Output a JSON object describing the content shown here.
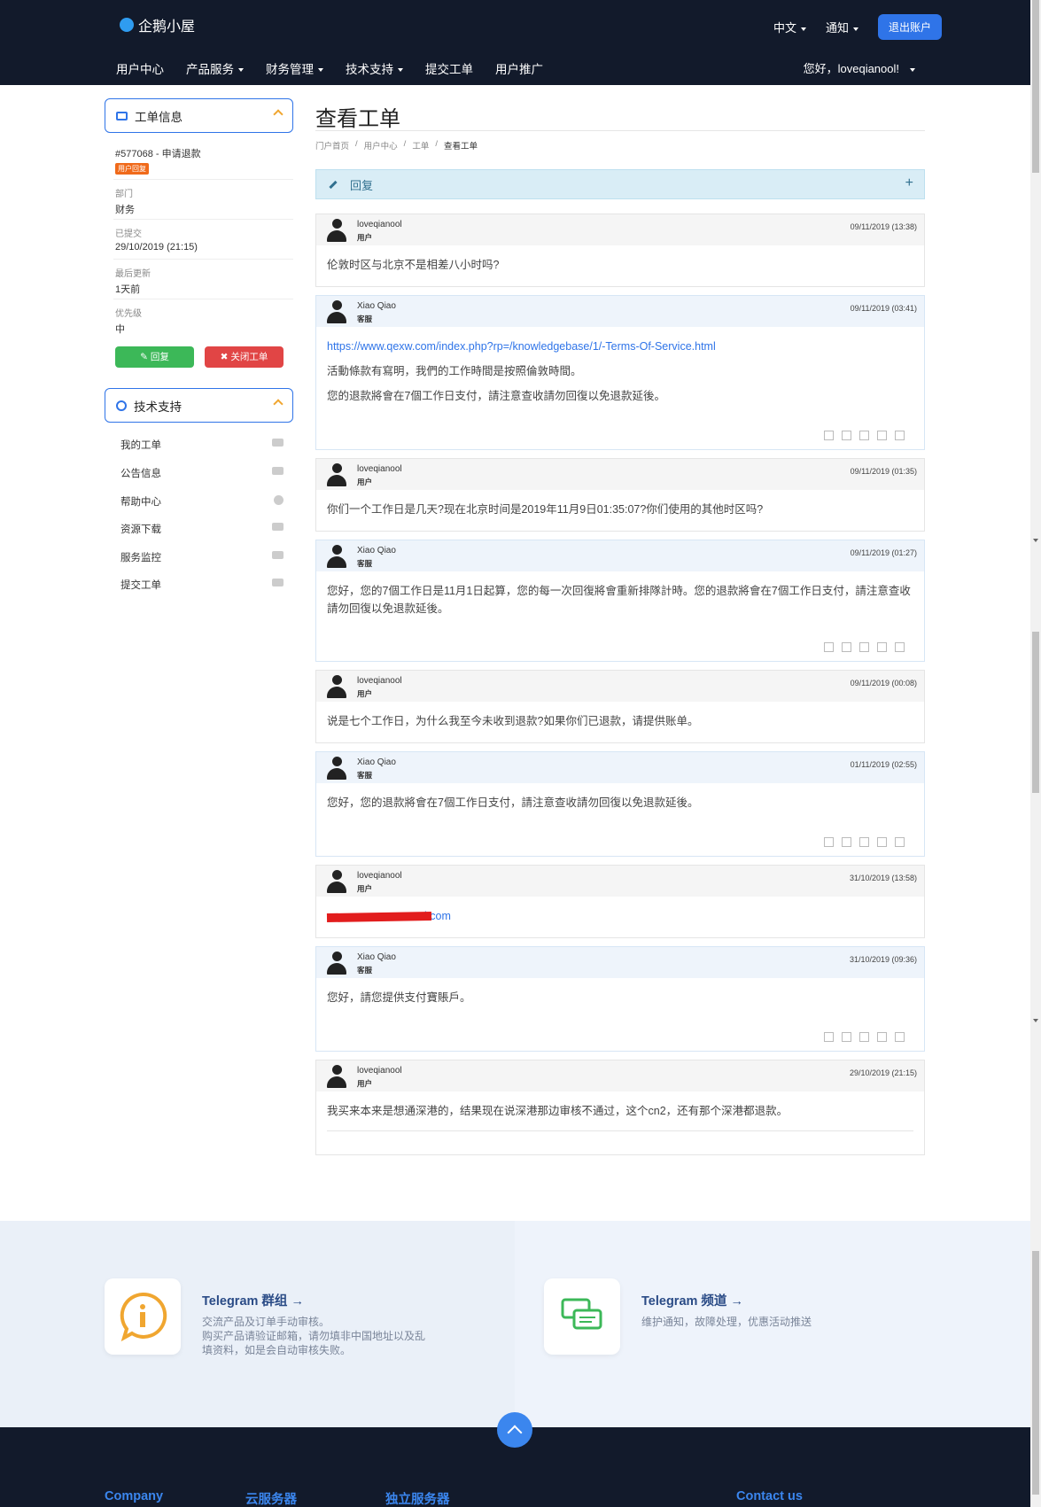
{
  "header": {
    "brand": "企鹅小屋",
    "language": "中文",
    "notifications": "通知",
    "logout": "退出账户",
    "nav": [
      "用户中心",
      "产品服务",
      "财务管理",
      "技术支持",
      "提交工单",
      "用户推广"
    ],
    "greeting": "您好，loveqianool!"
  },
  "sidebar": {
    "ticket_card_title": "工单信息",
    "ticket_id": "#577068 - 申请退款",
    "status_badge": "用户回复",
    "department_label": "部门",
    "department": "财务",
    "submitted_label": "已提交",
    "submitted": "29/10/2019 (21:15)",
    "updated_label": "最后更新",
    "updated": "1天前",
    "priority_label": "优先级",
    "priority": "中",
    "reply_btn": "回复",
    "close_btn": "关闭工单",
    "support_card_title": "技术支持",
    "menu": [
      "我的工单",
      "公告信息",
      "帮助中心",
      "资源下载",
      "服务监控",
      "提交工单"
    ]
  },
  "main": {
    "title": "查看工单",
    "breadcrumb": [
      "门户首页",
      "用户中心",
      "工单",
      "查看工单"
    ],
    "reply_bar": "回复",
    "plus": "+"
  },
  "messages": [
    {
      "name": "loveqianool",
      "role": "用户",
      "date": "09/11/2019 (13:38)",
      "lines": [
        "伦敦时区与北京不是相差八小时吗?"
      ]
    },
    {
      "name": "Xiao Qiao",
      "role": "客服",
      "date": "09/11/2019 (03:41)",
      "link": "https://www.qexw.com/index.php?rp=/knowledgebase/1/-Terms-Of-Service.html",
      "lines": [
        "活動條款有寫明，我們的工作時間是按照倫敦時間。",
        "您的退款將會在7個工作日支付，請注意查收請勿回復以免退款延後。"
      ]
    },
    {
      "name": "loveqianool",
      "role": "用户",
      "date": "09/11/2019 (01:35)",
      "lines": [
        "你们一个工作日是几天?现在北京时间是2019年11月9日01:35:07?你们使用的其他时区吗?"
      ]
    },
    {
      "name": "Xiao Qiao",
      "role": "客服",
      "date": "09/11/2019 (01:27)",
      "lines": [
        "您好，您的7個工作日是11月1日起算，您的每一次回復將會重新排隊計時。您的退款將會在7個工作日支付，請注意查收請勿回復以免退款延後。"
      ]
    },
    {
      "name": "loveqianool",
      "role": "用户",
      "date": "09/11/2019 (00:08)",
      "lines": [
        "说是七个工作日，为什么我至今未收到退款?如果你们已退款，请提供账单。"
      ]
    },
    {
      "name": "Xiao Qiao",
      "role": "客服",
      "date": "01/11/2019 (02:55)",
      "lines": [
        "您好，您的退款將會在7個工作日支付，請注意查收請勿回復以免退款延後。"
      ]
    },
    {
      "name": "loveqianool",
      "role": "用户",
      "date": "31/10/2019 (13:58)",
      "email_suffix": "l.com"
    },
    {
      "name": "Xiao Qiao",
      "role": "客服",
      "date": "31/10/2019 (09:36)",
      "lines": [
        "您好，請您提供支付寶賬戶。"
      ]
    },
    {
      "name": "loveqianool",
      "role": "用户",
      "date": "29/10/2019 (21:15)",
      "lines": [
        "我买来本来是想通深港的，结果现在说深港那边审核不通过，这个cn2，还有那个深港都退款。"
      ]
    }
  ],
  "footer": {
    "cta1_title": "Telegram 群组 →",
    "cta1_text": [
      "交流产品及订单手动审核。",
      "购买产品请验证邮箱，请勿填非中国地址以及乱",
      "填资料，如是会自动审核失败。"
    ],
    "cta2_title": "Telegram 频道 →",
    "cta2_text": "维护通知，故障处理，优惠活动推送",
    "cols": [
      "Company",
      "云服务器",
      "独立服务器",
      "Contact us"
    ]
  }
}
